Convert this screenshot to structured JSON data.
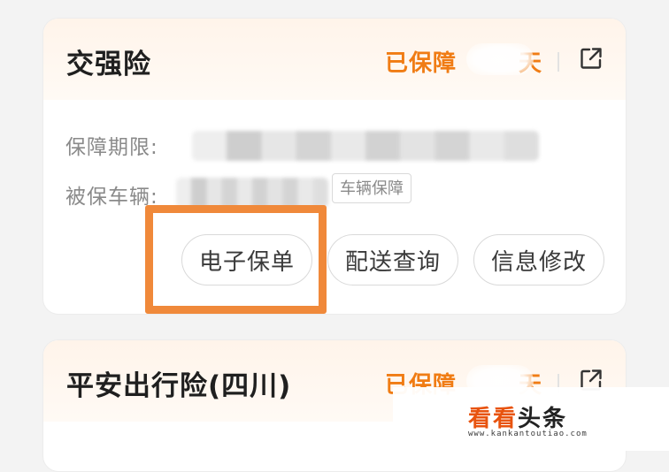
{
  "cards": [
    {
      "title": "交强险",
      "protect_days_prefix": "已保障",
      "protect_days_suffix": "天",
      "rows": {
        "period_label": "保障期限:",
        "vehicle_label": "被保车辆:",
        "vehicle_tag": "车辆保障"
      },
      "actions": {
        "policy": "电子保单",
        "delivery": "配送查询",
        "modify": "信息修改"
      }
    },
    {
      "title": "平安出行险(四川)",
      "protect_days_prefix": "已保障",
      "protect_days_suffix": "天"
    }
  ],
  "watermark": {
    "brand_orange": "看看",
    "brand_dark": "头条",
    "url": "www.kankantoutiao.com"
  },
  "colors": {
    "accent": "#f07c14",
    "highlight_border": "#f0893a",
    "header_bg": "#fff4ea",
    "watermark_orange": "#e8530e"
  },
  "icons": {
    "header_right": "external-link-icon"
  }
}
